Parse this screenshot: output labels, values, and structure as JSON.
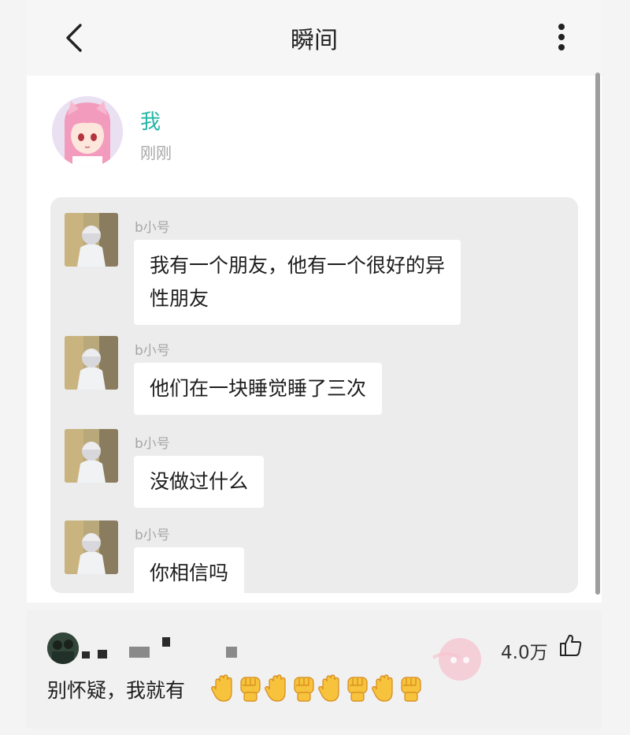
{
  "header": {
    "title": "瞬间",
    "back_icon": "chevron-left-icon",
    "more_icon": "more-vertical-icon"
  },
  "post": {
    "author": "我",
    "time": "刚刚",
    "author_color": "#27b5a6",
    "messages": [
      {
        "sender": "b小号",
        "text": "我有一个朋友，他有一个很好的异\n性朋友"
      },
      {
        "sender": "b小号",
        "text": "他们在一块睡觉睡了三次"
      },
      {
        "sender": "b小号",
        "text": "没做过什么"
      },
      {
        "sender": "b小号",
        "text": "你相信吗"
      }
    ]
  },
  "comment": {
    "likes": "4.0万",
    "like_icon": "thumbs-up-icon",
    "text": "别怀疑，我就有",
    "emojis": [
      "raised-hand",
      "raised-fist",
      "raised-hand",
      "raised-fist",
      "raised-hand",
      "raised-fist",
      "raised-hand",
      "raised-fist"
    ]
  }
}
